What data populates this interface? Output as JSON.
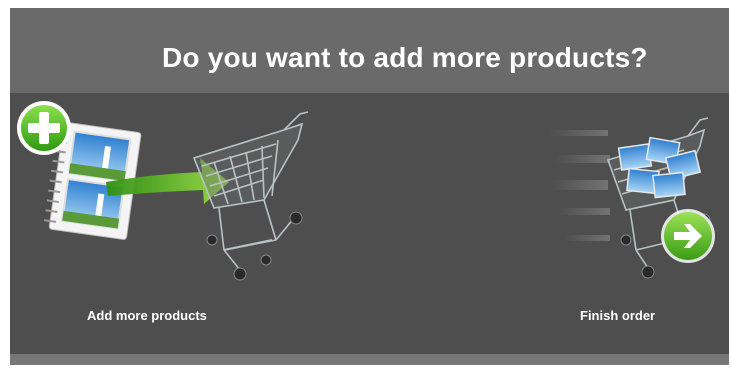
{
  "dialog": {
    "title": "Do you want to add more products?"
  },
  "options": {
    "add_more": {
      "label": "Add more products",
      "icons": [
        "plus-icon",
        "photo-album-icon",
        "green-arrow-icon",
        "shopping-cart-icon"
      ]
    },
    "finish": {
      "label": "Finish order",
      "icons": [
        "full-shopping-cart-icon",
        "arrow-right-icon"
      ]
    }
  },
  "colors": {
    "header_bg": "#6a6a6a",
    "body_bg": "#4e4e4e",
    "footer_bg": "#777777",
    "accent_green": "#5fbf2a",
    "text": "#ffffff"
  }
}
